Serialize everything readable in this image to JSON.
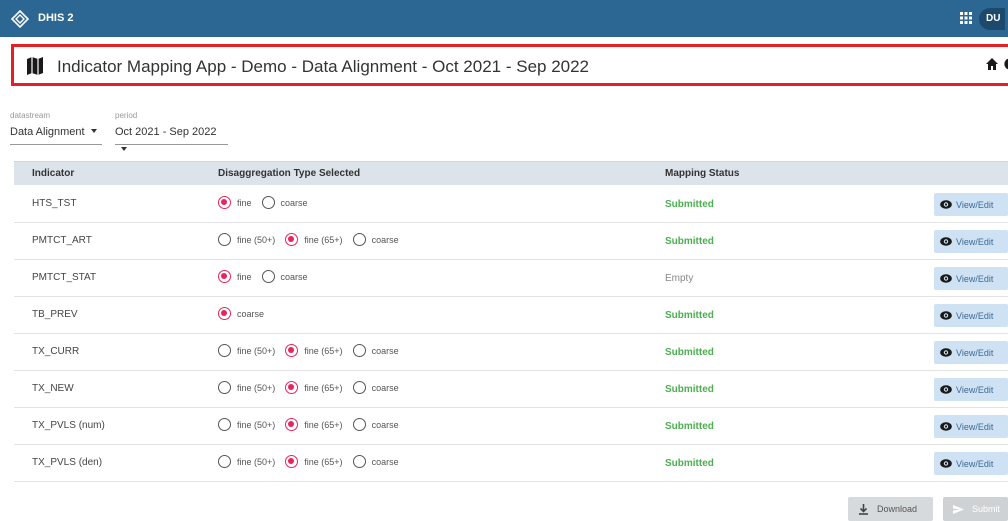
{
  "header": {
    "app_name": "DHIS 2",
    "avatar_initials": "DU",
    "brand_color": "#2c6693"
  },
  "titlebar": {
    "title": "Indicator Mapping App - Demo - Data Alignment - Oct 2021 - Sep 2022",
    "highlight_color": "#e41f26"
  },
  "selectors": {
    "datastream": {
      "label": "datastream",
      "value": "Data Alignment"
    },
    "period": {
      "label": "period",
      "value": "Oct 2021 - Sep 2022"
    }
  },
  "table": {
    "headers": {
      "indicator": "Indicator",
      "disagg": "Disaggregation Type Selected",
      "status": "Mapping Status"
    },
    "rows": [
      {
        "indicator": "HTS_TST",
        "options": [
          {
            "label": "fine",
            "selected": true
          },
          {
            "label": "coarse",
            "selected": false
          }
        ],
        "status": "Submitted",
        "action": "View/Edit"
      },
      {
        "indicator": "PMTCT_ART",
        "options": [
          {
            "label": "fine (50+)",
            "selected": false
          },
          {
            "label": "fine (65+)",
            "selected": true
          },
          {
            "label": "coarse",
            "selected": false
          }
        ],
        "status": "Submitted",
        "action": "View/Edit"
      },
      {
        "indicator": "PMTCT_STAT",
        "options": [
          {
            "label": "fine",
            "selected": true
          },
          {
            "label": "coarse",
            "selected": false
          }
        ],
        "status": "Empty",
        "action": "View/Edit"
      },
      {
        "indicator": "TB_PREV",
        "options": [
          {
            "label": "coarse",
            "selected": true
          }
        ],
        "status": "Submitted",
        "action": "View/Edit"
      },
      {
        "indicator": "TX_CURR",
        "options": [
          {
            "label": "fine (50+)",
            "selected": false
          },
          {
            "label": "fine (65+)",
            "selected": true
          },
          {
            "label": "coarse",
            "selected": false
          }
        ],
        "status": "Submitted",
        "action": "View/Edit"
      },
      {
        "indicator": "TX_NEW",
        "options": [
          {
            "label": "fine (50+)",
            "selected": false
          },
          {
            "label": "fine (65+)",
            "selected": true
          },
          {
            "label": "coarse",
            "selected": false
          }
        ],
        "status": "Submitted",
        "action": "View/Edit"
      },
      {
        "indicator": "TX_PVLS (num)",
        "options": [
          {
            "label": "fine (50+)",
            "selected": false
          },
          {
            "label": "fine (65+)",
            "selected": true
          },
          {
            "label": "coarse",
            "selected": false
          }
        ],
        "status": "Submitted",
        "action": "View/Edit"
      },
      {
        "indicator": "TX_PVLS (den)",
        "options": [
          {
            "label": "fine (50+)",
            "selected": false
          },
          {
            "label": "fine (65+)",
            "selected": true
          },
          {
            "label": "coarse",
            "selected": false
          }
        ],
        "status": "Submitted",
        "action": "View/Edit"
      }
    ]
  },
  "footer": {
    "download_label": "Download",
    "submit_label": "Submit"
  },
  "colors": {
    "radio_selected": "#e8245e",
    "status_submitted": "#4caf50",
    "status_empty": "#888888",
    "view_button_bg": "#cfe2f3"
  }
}
